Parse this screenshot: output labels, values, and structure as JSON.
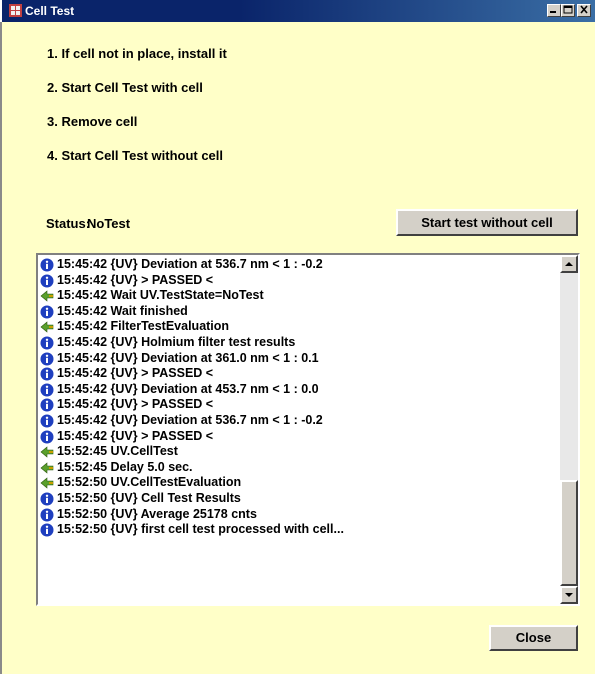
{
  "window": {
    "title": "Cell Test"
  },
  "steps": [
    "1. If cell not in place, install it",
    "2. Start Cell Test with cell",
    "3. Remove cell",
    "4. Start Cell Test without cell"
  ],
  "status": {
    "label": "Status:",
    "value": "NoTest"
  },
  "buttons": {
    "start_test": "Start test without cell",
    "close": "Close"
  },
  "log": [
    {
      "icon": "info-icon",
      "text": "15:45:42 {UV} Deviation at 536.7 nm < 1 : -0.2"
    },
    {
      "icon": "info-icon",
      "text": "15:45:42 {UV} > PASSED <"
    },
    {
      "icon": "command-icon",
      "text": "15:45:42 Wait  UV.TestState=NoTest"
    },
    {
      "icon": "info-icon",
      "text": "15:45:42 Wait finished"
    },
    {
      "icon": "command-icon",
      "text": "15:45:42 FilterTestEvaluation"
    },
    {
      "icon": "info-icon",
      "text": "15:45:42 {UV} Holmium filter test results"
    },
    {
      "icon": "info-icon",
      "text": "15:45:42 {UV} Deviation at 361.0 nm < 1 : 0.1"
    },
    {
      "icon": "info-icon",
      "text": "15:45:42 {UV} > PASSED <"
    },
    {
      "icon": "info-icon",
      "text": "15:45:42 {UV} Deviation at 453.7 nm < 1 : 0.0"
    },
    {
      "icon": "info-icon",
      "text": "15:45:42 {UV} > PASSED <"
    },
    {
      "icon": "info-icon",
      "text": "15:45:42 {UV} Deviation at 536.7 nm < 1 : -0.2"
    },
    {
      "icon": "info-icon",
      "text": "15:45:42 {UV} > PASSED <"
    },
    {
      "icon": "command-icon",
      "text": "15:52:45 UV.CellTest"
    },
    {
      "icon": "command-icon",
      "text": "15:52:45 Delay 5.0 sec."
    },
    {
      "icon": "command-icon",
      "text": "15:52:50 UV.CellTestEvaluation"
    },
    {
      "icon": "info-icon",
      "text": "15:52:50 {UV} Cell Test Results"
    },
    {
      "icon": "info-icon",
      "text": "15:52:50 {UV} Average 25178 cnts"
    },
    {
      "icon": "info-icon",
      "text": "15:52:50 {UV} first cell test processed with cell..."
    }
  ],
  "colors": {
    "background": "#ffffc8",
    "titlebar": "#0a246a",
    "info_icon": "#1f3fbf",
    "command_icon": "#5aa02c"
  }
}
